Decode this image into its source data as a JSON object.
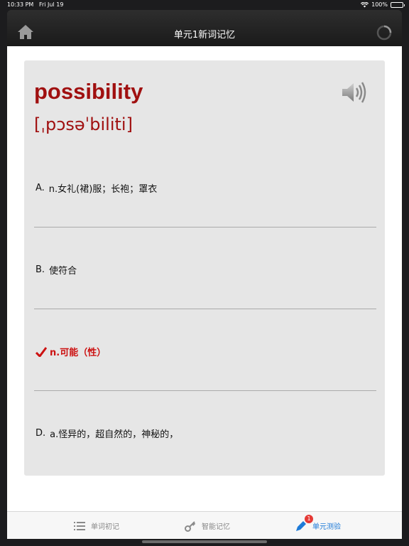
{
  "status_bar": {
    "time": "10:33 PM",
    "date": "Fri Jul 19",
    "battery": "100%"
  },
  "nav": {
    "title": "单元1新词记忆"
  },
  "card": {
    "word": "possibility",
    "phonetic": "[ˌpɔsəˈbiliti]",
    "options": [
      {
        "letter": "A.",
        "text": "n.女礼(裙)服；长袍；罩衣"
      },
      {
        "letter": "B.",
        "text": "使符合"
      },
      {
        "letter": "",
        "text": "n.可能（性）"
      },
      {
        "letter": "D.",
        "text": "a.怪异的，超自然的，神秘的，"
      }
    ]
  },
  "tabs": [
    {
      "label": "单词初记"
    },
    {
      "label": "智能记忆"
    },
    {
      "label": "单元测验",
      "badge": "1"
    }
  ],
  "colors": {
    "word": "#a01010",
    "correct": "#cc1111",
    "active_tab": "#1e7bd8"
  }
}
